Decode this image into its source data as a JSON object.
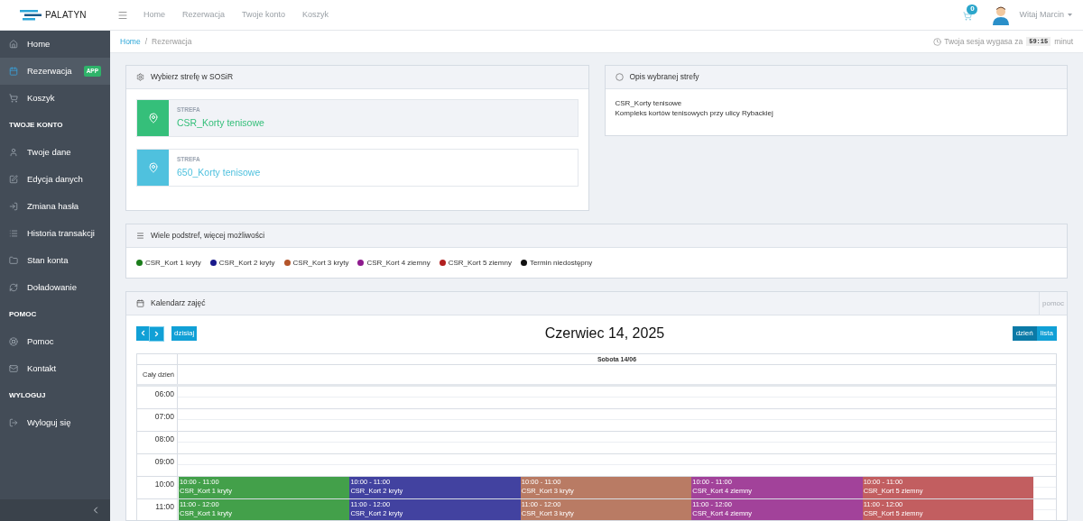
{
  "brand": "PALATYN",
  "top_nav": [
    "Home",
    "Rezerwacja",
    "Twoje konto",
    "Koszyk"
  ],
  "cart_count": "0",
  "user_greeting": "Witaj Marcin",
  "sidebar": [
    {
      "kind": "item",
      "label": "Home",
      "selected": false
    },
    {
      "kind": "item",
      "label": "Rezerwacja",
      "selected": true,
      "badge": "APP"
    },
    {
      "kind": "item",
      "label": "Koszyk",
      "selected": false
    },
    {
      "kind": "section",
      "label": "TWOJE KONTO"
    },
    {
      "kind": "item",
      "label": "Twoje dane",
      "selected": false
    },
    {
      "kind": "item",
      "label": "Edycja danych",
      "selected": false
    },
    {
      "kind": "item",
      "label": "Zmiana hasła",
      "selected": false
    },
    {
      "kind": "item",
      "label": "Historia transakcji",
      "selected": false
    },
    {
      "kind": "item",
      "label": "Stan konta",
      "selected": false
    },
    {
      "kind": "item",
      "label": "Doładowanie",
      "selected": false
    },
    {
      "kind": "section",
      "label": "POMOC"
    },
    {
      "kind": "item",
      "label": "Pomoc",
      "selected": false
    },
    {
      "kind": "item",
      "label": "Kontakt",
      "selected": false
    },
    {
      "kind": "section",
      "label": "WYLOGUJ"
    },
    {
      "kind": "item",
      "label": "Wyloguj się",
      "selected": false
    }
  ],
  "breadcrumb": [
    "Home",
    "Rezerwacja"
  ],
  "breadcrumb_separator": "/",
  "session": {
    "before": "Twoja sesja wygasa za",
    "time": "59:15",
    "after": "minut"
  },
  "zone_panel": {
    "title": "Wybierz strefę w SOSiR",
    "zones": [
      {
        "label": "STREFA",
        "name": "CSR_Korty tenisowe",
        "color": "#35bf7a",
        "selected": true
      },
      {
        "label": "STREFA",
        "name": "650_Korty tenisowe",
        "color": "#4fc1de",
        "selected": false
      }
    ]
  },
  "description_panel": {
    "title": "Opis wybranej strefy",
    "lines": [
      "CSR_Korty tenisowe",
      "Kompleks kortów tenisowych przy ulicy Rybackiej"
    ]
  },
  "legend_panel": {
    "title": "Wiele podstref, więcej możliwości",
    "items": [
      {
        "label": "CSR_Kort 1 kryty",
        "color": "#1b7d1b"
      },
      {
        "label": "CSR_Kort 2 kryty",
        "color": "#1a1a8c"
      },
      {
        "label": "CSR_Kort 3 kryty",
        "color": "#b4552b"
      },
      {
        "label": "CSR_Kort 4 ziemny",
        "color": "#8e1b8e"
      },
      {
        "label": "CSR_Kort 5 ziemny",
        "color": "#b21f1f"
      },
      {
        "label": "Termin niedostępny",
        "color": "#111111"
      }
    ]
  },
  "calendar": {
    "title": "Kalendarz zajęć",
    "help": "pomoc",
    "today": "dzisiaj",
    "date_title": "Czerwiec 14, 2025",
    "views": [
      {
        "label": "dzień",
        "selected": true
      },
      {
        "label": "lista",
        "selected": false
      }
    ],
    "day_header": "Sobota 14/06",
    "all_day": "Cały dzień",
    "slots": [
      {
        "time": "06:00"
      },
      {
        "time": "07:00"
      },
      {
        "time": "08:00"
      },
      {
        "time": "09:00"
      },
      {
        "time": "10:00",
        "events": [
          {
            "time": "10:00 - 11:00",
            "title": "CSR_Kort 1 kryty",
            "color": "#43a04a"
          },
          {
            "time": "10:00 - 11:00",
            "title": "CSR_Kort 2 kryty",
            "color": "#4242a0"
          },
          {
            "time": "10:00 - 11:00",
            "title": "CSR_Kort 3 kryty",
            "color": "#b97b64"
          },
          {
            "time": "10:00 - 11:00",
            "title": "CSR_Kort 4 ziemny",
            "color": "#a2429a"
          },
          {
            "time": "10:00 - 11:00",
            "title": "CSR_Kort 5 ziemny",
            "color": "#c25e60"
          }
        ]
      },
      {
        "time": "11:00",
        "events": [
          {
            "time": "11:00 - 12:00",
            "title": "CSR_Kort 1 kryty",
            "color": "#43a04a"
          },
          {
            "time": "11:00 - 12:00",
            "title": "CSR_Kort 2 kryty",
            "color": "#4242a0"
          },
          {
            "time": "11:00 - 12:00",
            "title": "CSR_Kort 3 kryty",
            "color": "#b97b64"
          },
          {
            "time": "11:00 - 12:00",
            "title": "CSR_Kort 4 ziemny",
            "color": "#a2429a"
          },
          {
            "time": "11:00 - 12:00",
            "title": "CSR_Kort 5 ziemny",
            "color": "#c25e60"
          }
        ]
      }
    ]
  }
}
